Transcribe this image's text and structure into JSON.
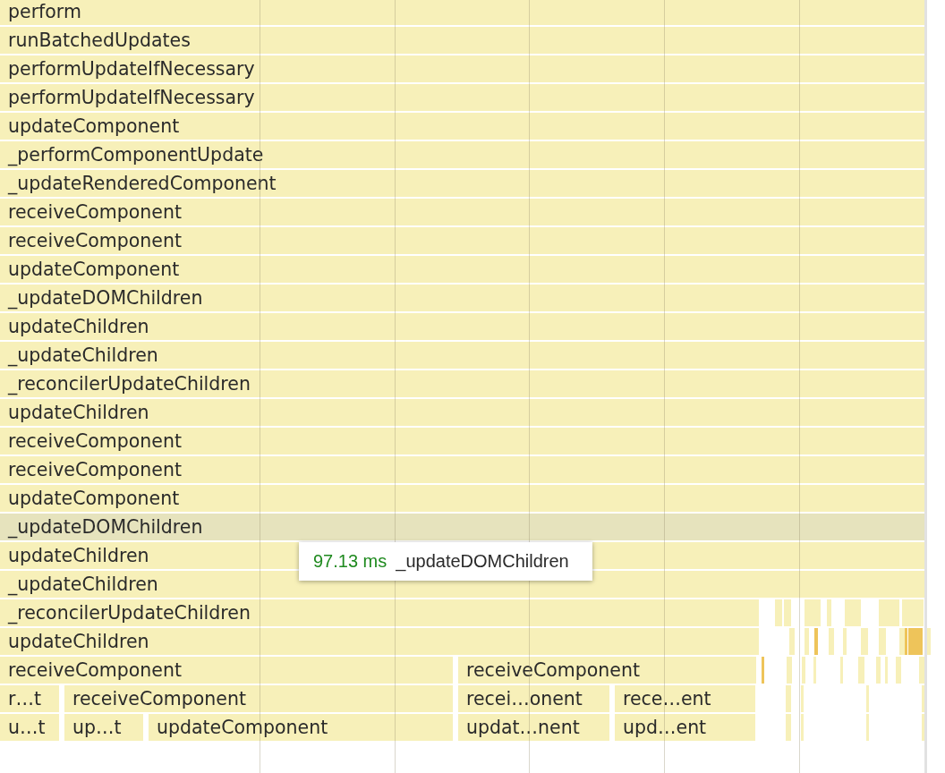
{
  "flame_chart": {
    "rows": [
      {
        "bars": [
          {
            "label": "perform",
            "selected": false
          }
        ]
      },
      {
        "bars": [
          {
            "label": "runBatchedUpdates",
            "selected": false
          }
        ]
      },
      {
        "bars": [
          {
            "label": "performUpdateIfNecessary",
            "selected": false
          }
        ]
      },
      {
        "bars": [
          {
            "label": "performUpdateIfNecessary",
            "selected": false
          }
        ]
      },
      {
        "bars": [
          {
            "label": "updateComponent",
            "selected": false
          }
        ]
      },
      {
        "bars": [
          {
            "label": "_performComponentUpdate",
            "selected": false
          }
        ]
      },
      {
        "bars": [
          {
            "label": "_updateRenderedComponent",
            "selected": false
          }
        ]
      },
      {
        "bars": [
          {
            "label": "receiveComponent",
            "selected": false
          }
        ]
      },
      {
        "bars": [
          {
            "label": "receiveComponent",
            "selected": false
          }
        ]
      },
      {
        "bars": [
          {
            "label": "updateComponent",
            "selected": false
          }
        ]
      },
      {
        "bars": [
          {
            "label": "_updateDOMChildren",
            "selected": false
          }
        ]
      },
      {
        "bars": [
          {
            "label": "updateChildren",
            "selected": false
          }
        ]
      },
      {
        "bars": [
          {
            "label": "_updateChildren",
            "selected": false
          }
        ]
      },
      {
        "bars": [
          {
            "label": "_reconcilerUpdateChildren",
            "selected": false
          }
        ]
      },
      {
        "bars": [
          {
            "label": "updateChildren",
            "selected": false
          }
        ]
      },
      {
        "bars": [
          {
            "label": "receiveComponent",
            "selected": false
          }
        ]
      },
      {
        "bars": [
          {
            "label": "receiveComponent",
            "selected": false
          }
        ]
      },
      {
        "bars": [
          {
            "label": "updateComponent",
            "selected": false
          }
        ]
      },
      {
        "bars": [
          {
            "label": "_updateDOMChildren",
            "selected": true
          }
        ]
      },
      {
        "bars": [
          {
            "label": "updateChildren",
            "selected": false
          }
        ]
      },
      {
        "bars": [
          {
            "label": "_updateChildren",
            "selected": false
          }
        ]
      },
      {
        "bars": [
          {
            "label": "_reconcilerUpdateChildren",
            "selected": false
          }
        ]
      },
      {
        "bars": [
          {
            "label": "updateChildren",
            "selected": false
          }
        ]
      },
      {
        "bars": [
          {
            "label": "receiveComponent",
            "selected": false
          },
          {
            "label": "receiveComponent",
            "selected": false
          }
        ]
      },
      {
        "bars": [
          {
            "label": "r…t",
            "selected": false
          },
          {
            "label": "receiveComponent",
            "selected": false
          },
          {
            "label": "recei…onent",
            "selected": false
          },
          {
            "label": "rece…ent",
            "selected": false
          }
        ]
      },
      {
        "bars": [
          {
            "label": "u…t",
            "selected": false
          },
          {
            "label": "up…t",
            "selected": false
          },
          {
            "label": "updateComponent",
            "selected": false
          },
          {
            "label": "updat…nent",
            "selected": false
          },
          {
            "label": "upd…ent",
            "selected": false
          }
        ]
      }
    ]
  },
  "tooltip": {
    "duration": "97.13 ms",
    "name": "_updateDOMChildren"
  }
}
